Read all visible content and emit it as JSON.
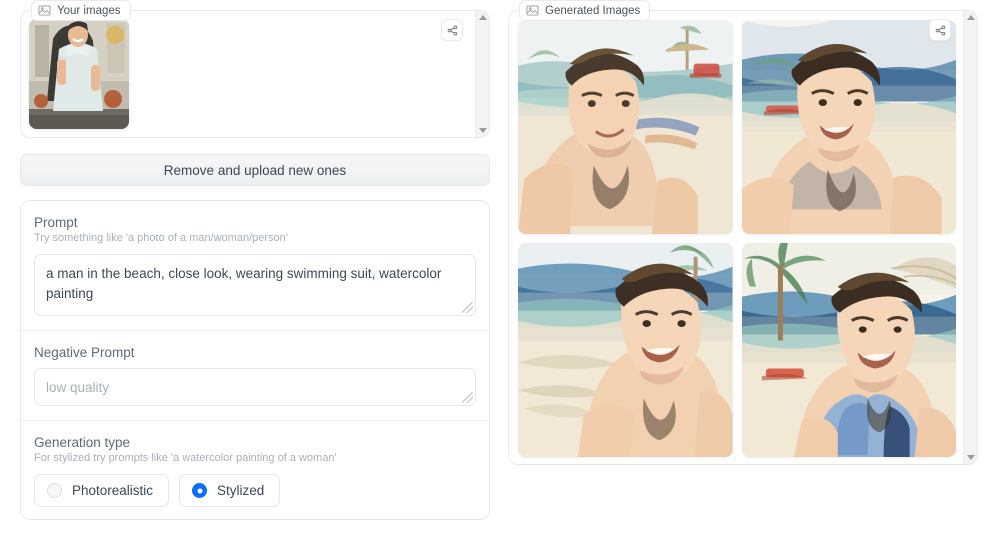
{
  "upload_panel": {
    "label": "Your images",
    "label_icon": "image-icon",
    "share_icon": "share-icon",
    "thumbnail_alt": "man in light shirt outdoors"
  },
  "remove_button": {
    "label": "Remove and upload new ones"
  },
  "form": {
    "prompt": {
      "title": "Prompt",
      "hint": "Try something like 'a photo of a man/woman/person'",
      "value": "a man in the beach, close look, wearing swimming suit, watercolor painting"
    },
    "negative_prompt": {
      "title": "Negative Prompt",
      "placeholder": "low quality",
      "value": ""
    },
    "generation_type": {
      "title": "Generation type",
      "hint": "For stylized try prompts like 'a watercolor painting of a woman'",
      "options": [
        {
          "label": "Photorealistic",
          "selected": false
        },
        {
          "label": "Stylized",
          "selected": true
        }
      ]
    }
  },
  "generated_panel": {
    "label": "Generated Images",
    "label_icon": "image-icon",
    "share_icon": "share-icon",
    "images": [
      {
        "alt": "watercolor shirtless man on beach with lounge chair"
      },
      {
        "alt": "watercolor smiling man with necklace at shoreline"
      },
      {
        "alt": "watercolor man smiling on sandy beach"
      },
      {
        "alt": "watercolor man in blue tank top under palm tree"
      }
    ]
  },
  "colors": {
    "accent": "#0d6efd",
    "panel_border": "#e8eaed",
    "text": "#3c4858",
    "muted": "#a9b0ba",
    "scrollbar_track": "#f2f3f4"
  }
}
